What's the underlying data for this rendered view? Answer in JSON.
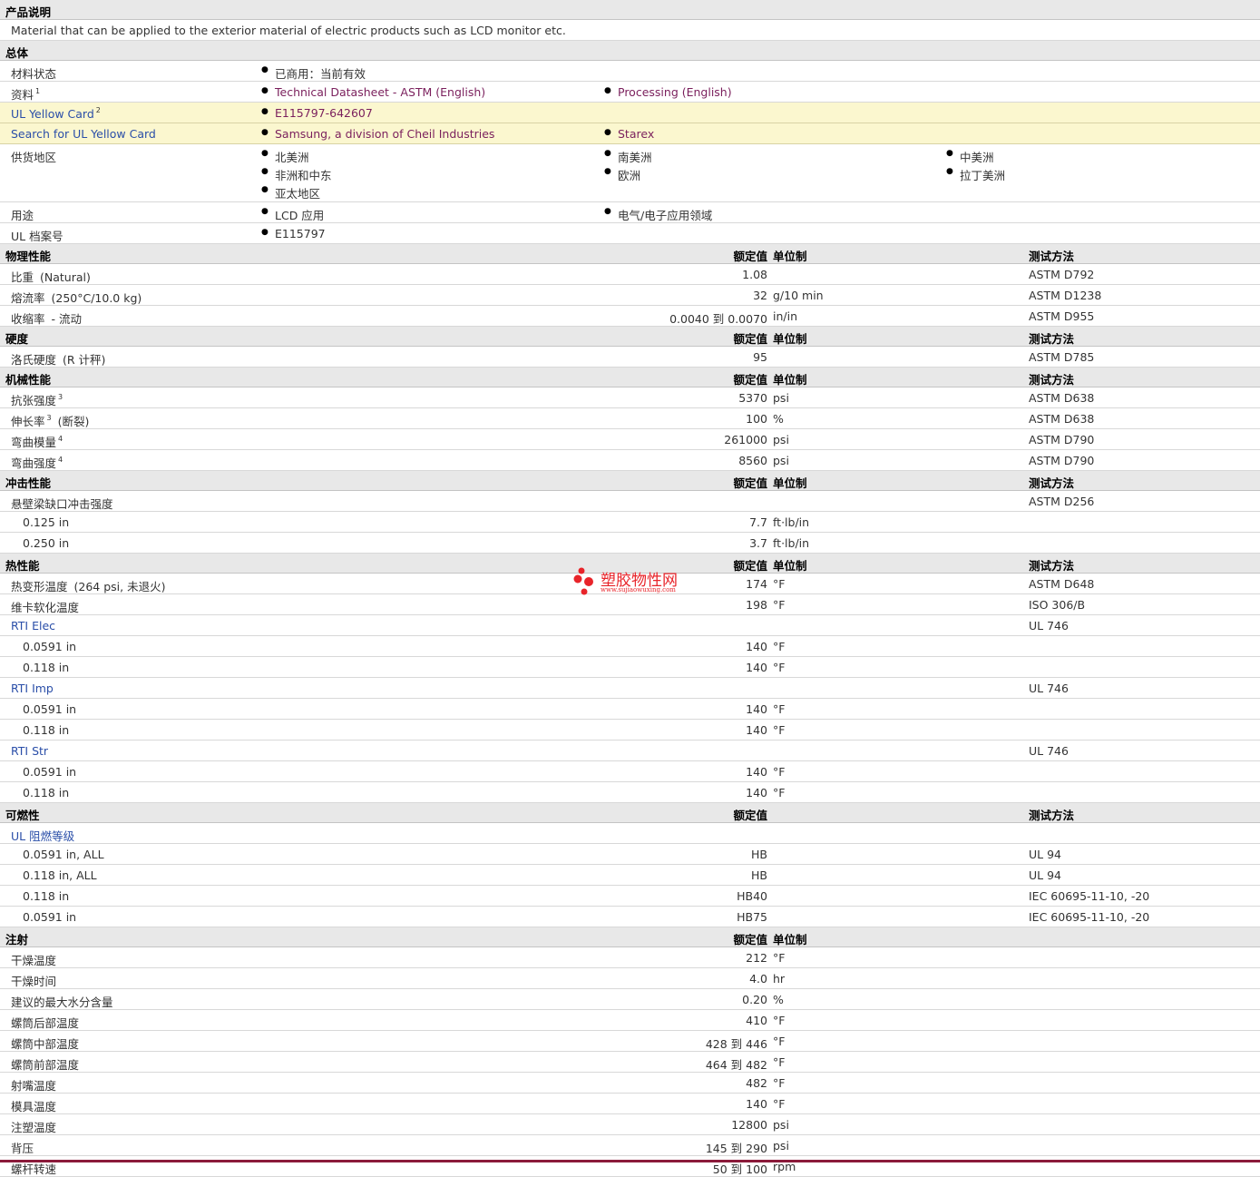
{
  "rows": [
    {
      "type": "header",
      "title": "产品说明"
    },
    {
      "type": "text",
      "text": "Material that can be applied to the exterior material of electric products such as LCD monitor etc."
    },
    {
      "type": "header",
      "title": "总体"
    },
    {
      "type": "info",
      "label": "材料状态",
      "items": [
        {
          "text": "已商用：当前有效"
        }
      ]
    },
    {
      "type": "info",
      "label": "资料",
      "sup": "1",
      "items": [
        {
          "text": "Technical Datasheet - ASTM (English)",
          "link": true
        },
        {
          "text": "Processing (English)",
          "link": true
        }
      ]
    },
    {
      "type": "info",
      "style": "yellow",
      "label": "UL Yellow Card",
      "sup": "2",
      "items": [
        {
          "text": "E115797-642607",
          "link": true
        }
      ]
    },
    {
      "type": "info",
      "style": "yellow",
      "label": "Search for UL Yellow Card",
      "items": [
        {
          "text": "Samsung, a division of Cheil Industries",
          "link": true
        },
        {
          "text": "Starex",
          "link": true
        }
      ]
    },
    {
      "type": "info",
      "label": "供货地区",
      "items": [
        {
          "text": "北美洲"
        },
        {
          "text": "南美洲"
        },
        {
          "text": "中美洲"
        },
        {
          "text": "非洲和中东"
        },
        {
          "text": "欧洲"
        },
        {
          "text": "拉丁美洲"
        },
        {
          "text": "亚太地区"
        }
      ]
    },
    {
      "type": "info",
      "label": "用途",
      "items": [
        {
          "text": "LCD 应用"
        },
        {
          "text": "电气/电子应用领域"
        }
      ]
    },
    {
      "type": "info",
      "label": "UL 档案号",
      "items": [
        {
          "text": "E115797"
        }
      ]
    },
    {
      "type": "header",
      "title": "物理性能",
      "value_h": "额定值",
      "unit_h": "单位制",
      "test_h": "测试方法"
    },
    {
      "type": "data",
      "label": "比重",
      "cond": "(Natural)",
      "value": "1.08",
      "test": "ASTM D792"
    },
    {
      "type": "data",
      "label": "熔流率",
      "cond": "(250°C/10.0 kg)",
      "value": "32",
      "unit": "g/10 min",
      "test": "ASTM D1238"
    },
    {
      "type": "data",
      "label": "收缩率",
      "cond": "- 流动",
      "value": "0.0040 到  0.0070",
      "unit": "in/in",
      "test": "ASTM D955"
    },
    {
      "type": "header",
      "title": "硬度",
      "value_h": "额定值",
      "unit_h": "单位制",
      "test_h": "测试方法"
    },
    {
      "type": "data",
      "label": "洛氏硬度",
      "cond": "(R 计秤)",
      "value": "95",
      "test": "ASTM D785"
    },
    {
      "type": "header",
      "title": "机械性能",
      "value_h": "额定值",
      "unit_h": "单位制",
      "test_h": "测试方法"
    },
    {
      "type": "data",
      "label": "抗张强度",
      "sup": "3",
      "value": "5370",
      "unit": "psi",
      "test": "ASTM D638"
    },
    {
      "type": "data",
      "label": "伸长率",
      "sup": "3",
      "cond": "(断裂)",
      "value": "100",
      "unit": "%",
      "test": "ASTM D638"
    },
    {
      "type": "data",
      "label": "弯曲模量",
      "sup": "4",
      "value": "261000",
      "unit": "psi",
      "test": "ASTM D790"
    },
    {
      "type": "data",
      "label": "弯曲强度",
      "sup": "4",
      "value": "8560",
      "unit": "psi",
      "test": "ASTM D790"
    },
    {
      "type": "header",
      "title": "冲击性能",
      "value_h": "额定值",
      "unit_h": "单位制",
      "test_h": "测试方法"
    },
    {
      "type": "data",
      "label": "悬壁梁缺口冲击强度",
      "test": "ASTM D256"
    },
    {
      "type": "data",
      "sub": true,
      "label": "0.125 in",
      "value": "7.7",
      "unit": "ft·lb/in"
    },
    {
      "type": "data",
      "sub": true,
      "label": "0.250 in",
      "value": "3.7",
      "unit": "ft·lb/in"
    },
    {
      "type": "header",
      "title": "热性能",
      "value_h": "额定值",
      "unit_h": "单位制",
      "test_h": "测试方法"
    },
    {
      "type": "data",
      "label": "热变形温度",
      "cond": "(264 psi, 未退火)",
      "value": "174",
      "unit": "°F",
      "test": "ASTM D648"
    },
    {
      "type": "data",
      "label": "维卡软化温度",
      "value": "198",
      "unit": "°F",
      "test": "ISO 306/B"
    },
    {
      "type": "data",
      "label": "RTI Elec",
      "blue": true,
      "test": "UL 746"
    },
    {
      "type": "data",
      "sub": true,
      "label": "0.0591 in",
      "value": "140",
      "unit": "°F"
    },
    {
      "type": "data",
      "sub": true,
      "label": "0.118 in",
      "value": "140",
      "unit": "°F"
    },
    {
      "type": "data",
      "label": "RTI Imp",
      "blue": true,
      "test": "UL 746"
    },
    {
      "type": "data",
      "sub": true,
      "label": "0.0591 in",
      "value": "140",
      "unit": "°F"
    },
    {
      "type": "data",
      "sub": true,
      "label": "0.118 in",
      "value": "140",
      "unit": "°F"
    },
    {
      "type": "data",
      "label": "RTI Str",
      "blue": true,
      "test": "UL 746"
    },
    {
      "type": "data",
      "sub": true,
      "label": "0.0591 in",
      "value": "140",
      "unit": "°F"
    },
    {
      "type": "data",
      "sub": true,
      "label": "0.118 in",
      "value": "140",
      "unit": "°F"
    },
    {
      "type": "header",
      "title": "可燃性",
      "value_h": "额定值",
      "test_h": "测试方法"
    },
    {
      "type": "data",
      "label": "UL 阻燃等级",
      "blue": true
    },
    {
      "type": "data",
      "sub": true,
      "label": "0.0591 in, ALL",
      "value": "HB",
      "test": "UL 94"
    },
    {
      "type": "data",
      "sub": true,
      "label": "0.118 in, ALL",
      "value": "HB",
      "test": "UL 94"
    },
    {
      "type": "data",
      "sub": true,
      "label": "0.118 in",
      "value": "HB40",
      "test": "IEC 60695-11-10, -20"
    },
    {
      "type": "data",
      "sub": true,
      "label": "0.0591 in",
      "value": "HB75",
      "test": "IEC 60695-11-10, -20"
    },
    {
      "type": "header",
      "title": "注射",
      "value_h": "额定值",
      "unit_h": "单位制"
    },
    {
      "type": "data",
      "label": "干燥温度",
      "value": "212",
      "unit": "°F"
    },
    {
      "type": "data",
      "label": "干燥时间",
      "value": "4.0",
      "unit": "hr"
    },
    {
      "type": "data",
      "label": "建议的最大水分含量",
      "value": "0.20",
      "unit": "%"
    },
    {
      "type": "data",
      "label": "螺筒后部温度",
      "value": "410",
      "unit": "°F"
    },
    {
      "type": "data",
      "label": "螺筒中部温度",
      "value": "428 到  446",
      "unit": "°F"
    },
    {
      "type": "data",
      "label": "螺筒前部温度",
      "value": "464 到  482",
      "unit": "°F"
    },
    {
      "type": "data",
      "label": "射嘴温度",
      "value": "482",
      "unit": "°F"
    },
    {
      "type": "data",
      "label": "模具温度",
      "value": "140",
      "unit": "°F"
    },
    {
      "type": "data",
      "label": "注塑温度",
      "value": "12800",
      "unit": "psi"
    },
    {
      "type": "data",
      "label": "背压",
      "value": "145 到  290",
      "unit": "psi"
    },
    {
      "type": "data",
      "label": "螺杆转速",
      "value": "50 到  100",
      "unit": "rpm"
    }
  ],
  "watermark": {
    "title": "塑胶物性网",
    "url": "www.sujiaowuxing.com"
  },
  "colors": {
    "header_bg": "#e8e8e8",
    "highlight_bg": "#fbf7cf",
    "link": "#7a1f5c",
    "watermark": "#e8242a"
  }
}
